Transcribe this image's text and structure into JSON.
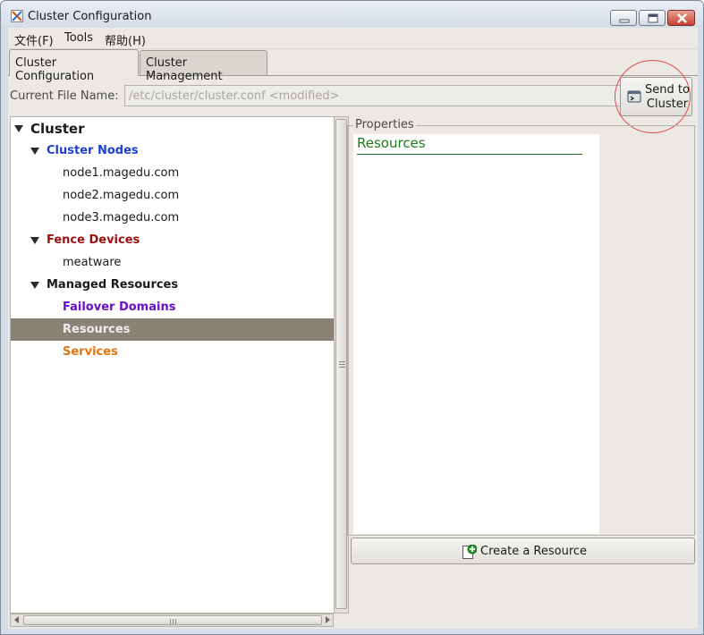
{
  "window": {
    "title": "Cluster Configuration",
    "app_icon": "cluster-config-icon",
    "controls": [
      "minimize-icon",
      "maximize-icon",
      "close-icon"
    ]
  },
  "menubar": {
    "items": [
      {
        "label": "文件(F)"
      },
      {
        "label": "Tools"
      },
      {
        "label": "帮助(H)"
      }
    ]
  },
  "tabs": [
    {
      "label": "Cluster Configuration",
      "active": true
    },
    {
      "label": "Cluster Management",
      "active": false
    }
  ],
  "file": {
    "label": "Current File Name:",
    "value": "/etc/cluster/cluster.conf <modified>"
  },
  "send_button": {
    "label": "Send to\nCluster",
    "icon": "send-to-cluster-icon"
  },
  "tree": {
    "root": {
      "label": "Cluster",
      "color": "#1a1a1a"
    },
    "nodes_group": {
      "label": "Cluster Nodes",
      "color": "#1f3fd0"
    },
    "nodes": [
      {
        "label": "node1.magedu.com"
      },
      {
        "label": "node2.magedu.com"
      },
      {
        "label": "node3.magedu.com"
      }
    ],
    "fence_group": {
      "label": "Fence Devices",
      "color": "#9c1010"
    },
    "fence_devices": [
      {
        "label": "meatware"
      }
    ],
    "managed_group": {
      "label": "Managed Resources",
      "color": "#1a1a1a"
    },
    "failover": {
      "label": "Failover Domains",
      "color": "#6a10c8"
    },
    "resources": {
      "label": "Resources",
      "color": "#eeeeee",
      "selected": true
    },
    "services": {
      "label": "Services",
      "color": "#e8720c"
    }
  },
  "properties": {
    "title": "Properties",
    "heading": "Resources",
    "heading_color": "#1e7a1e"
  },
  "create_button": {
    "label": "Create a Resource",
    "icon": "add-resource-icon"
  }
}
